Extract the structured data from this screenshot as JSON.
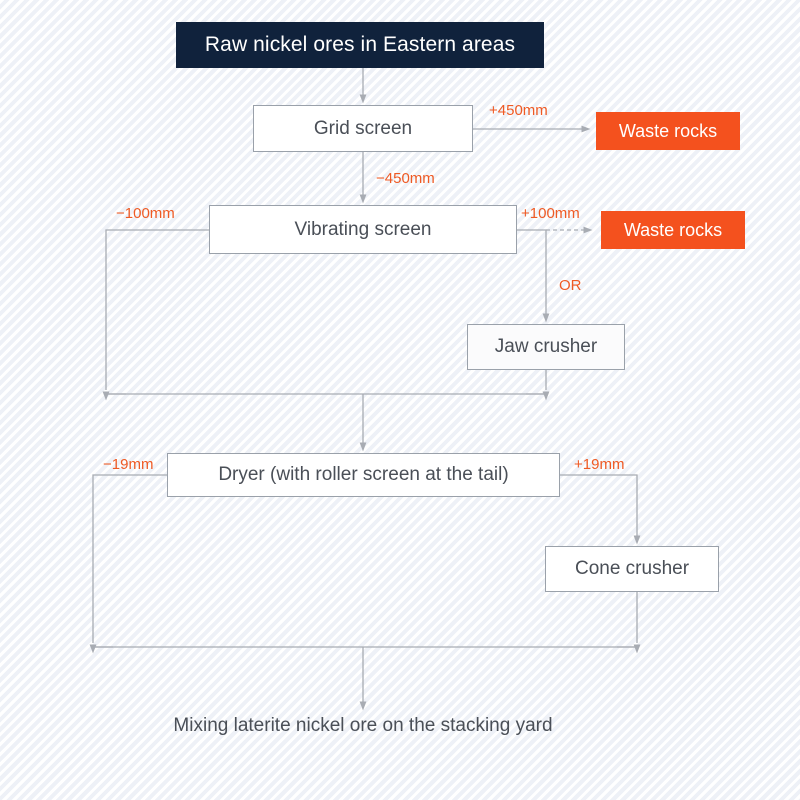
{
  "diagram": {
    "title_node": {
      "label": "Raw nickel ores in Eastern areas"
    },
    "nodes": [
      {
        "id": "grid-screen",
        "label": "Grid screen"
      },
      {
        "id": "waste-rocks-1",
        "label": "Waste rocks"
      },
      {
        "id": "vibrating-screen",
        "label": "Vibrating screen"
      },
      {
        "id": "waste-rocks-2",
        "label": "Waste rocks"
      },
      {
        "id": "jaw-crusher",
        "label": "Jaw crusher"
      },
      {
        "id": "dryer",
        "label": "Dryer (with roller screen at the tail)"
      },
      {
        "id": "cone-crusher",
        "label": "Cone crusher"
      },
      {
        "id": "stacking-yard",
        "label": "Mixing laterite nickel ore on the stacking yard"
      }
    ],
    "edge_labels": [
      {
        "id": "plus-450",
        "text": "+450mm"
      },
      {
        "id": "minus-450",
        "text": "−450mm"
      },
      {
        "id": "minus-100",
        "text": "−100mm"
      },
      {
        "id": "plus-100",
        "text": "+100mm"
      },
      {
        "id": "or",
        "text": "OR"
      },
      {
        "id": "minus-19",
        "text": "−19mm"
      },
      {
        "id": "plus-19",
        "text": "+19mm"
      }
    ],
    "colors": {
      "header_fill": "#10223c",
      "waste_fill": "#f4511e",
      "label_text": "#ef5a24",
      "box_text": "#4a4f57",
      "box_border": "#9aa1aa",
      "edge_line": "#a8acb3",
      "background": "#f5f7fb"
    }
  }
}
